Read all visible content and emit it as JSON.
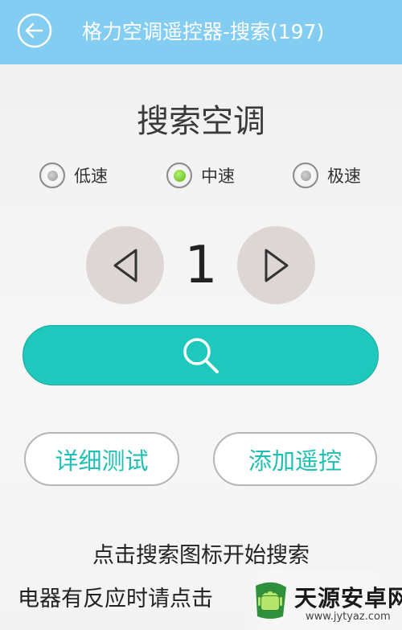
{
  "header": {
    "title": "格力空调遥控器-搜索(197)",
    "back_icon": "back-arrow-icon",
    "background_color": "#84cdf2"
  },
  "main": {
    "heading": "搜索空调",
    "speed_options": [
      {
        "label": "低速",
        "selected": false
      },
      {
        "label": "中速",
        "selected": true
      },
      {
        "label": "极速",
        "selected": false
      }
    ],
    "stepper": {
      "value": "1",
      "prev_icon": "triangle-left-icon",
      "next_icon": "triangle-right-icon"
    },
    "search_button": {
      "icon": "search-icon",
      "color": "#1fc8bd"
    },
    "detail_test_label": "详细测试",
    "add_remote_label": "添加遥控",
    "hints": [
      "点击搜索图标开始搜索",
      "电器有反应时请点击"
    ]
  },
  "watermark": {
    "name": "天源安卓网",
    "url": "www.jytyaz.com"
  }
}
